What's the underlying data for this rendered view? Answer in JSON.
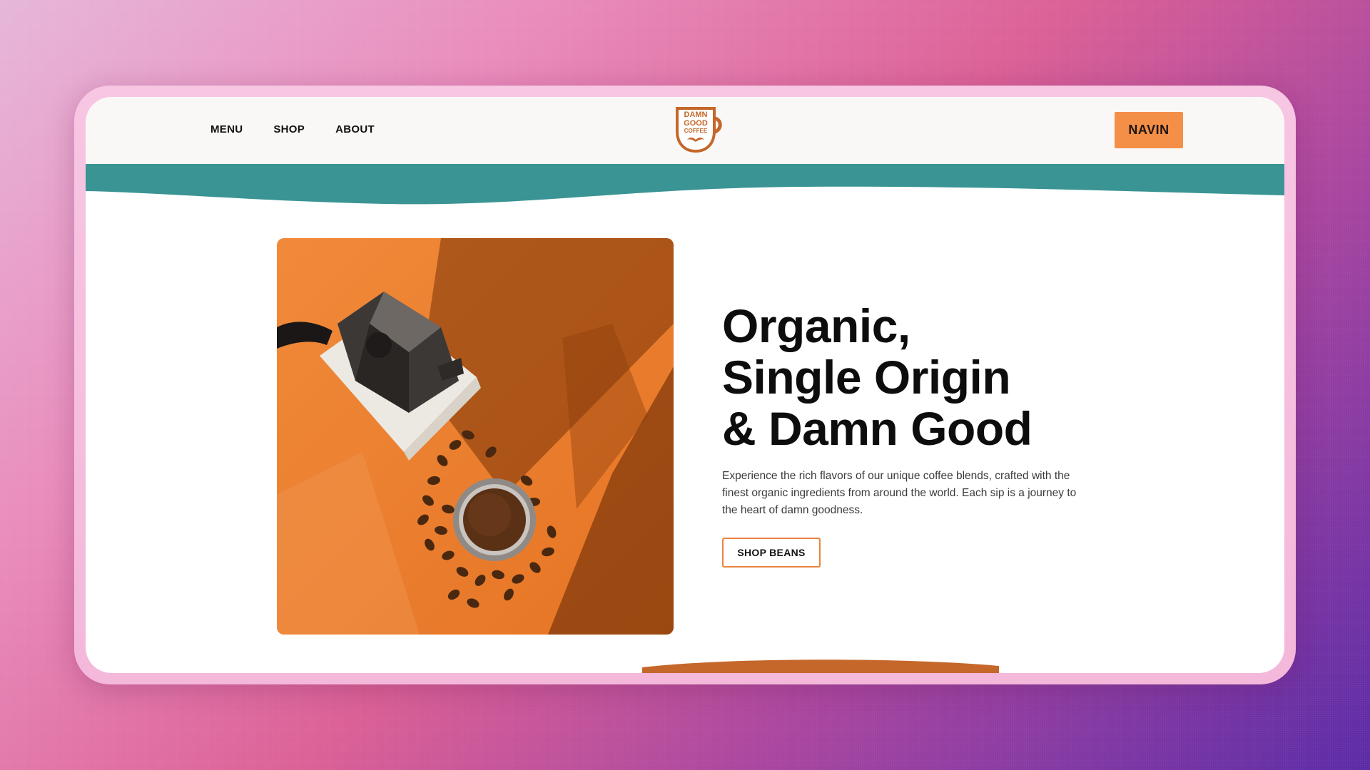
{
  "nav": {
    "items": [
      {
        "label": "MENU"
      },
      {
        "label": "SHOP"
      },
      {
        "label": "ABOUT"
      }
    ]
  },
  "logo": {
    "lines": [
      "DAMN",
      "GOOD",
      "COFFEE"
    ],
    "icon": "coffee-mug-logo"
  },
  "user": {
    "label": "NAVIN"
  },
  "hero": {
    "headline_lines": [
      "Organic,",
      "Single Origin",
      "& Damn Good"
    ],
    "description": "Experience the rich flavors of our unique coffee blends, crafted with the finest organic ingredients from around the world. Each sip is a journey to the heart of damn goodness.",
    "cta_label": "SHOP BEANS",
    "image_subject": "moka-pot-and-coffee-beans-photo"
  },
  "colors": {
    "accent": "#f48f48",
    "teal_band": "#3a9494",
    "brand_brown": "#c5672a",
    "photo_orange": "#e9802f"
  }
}
